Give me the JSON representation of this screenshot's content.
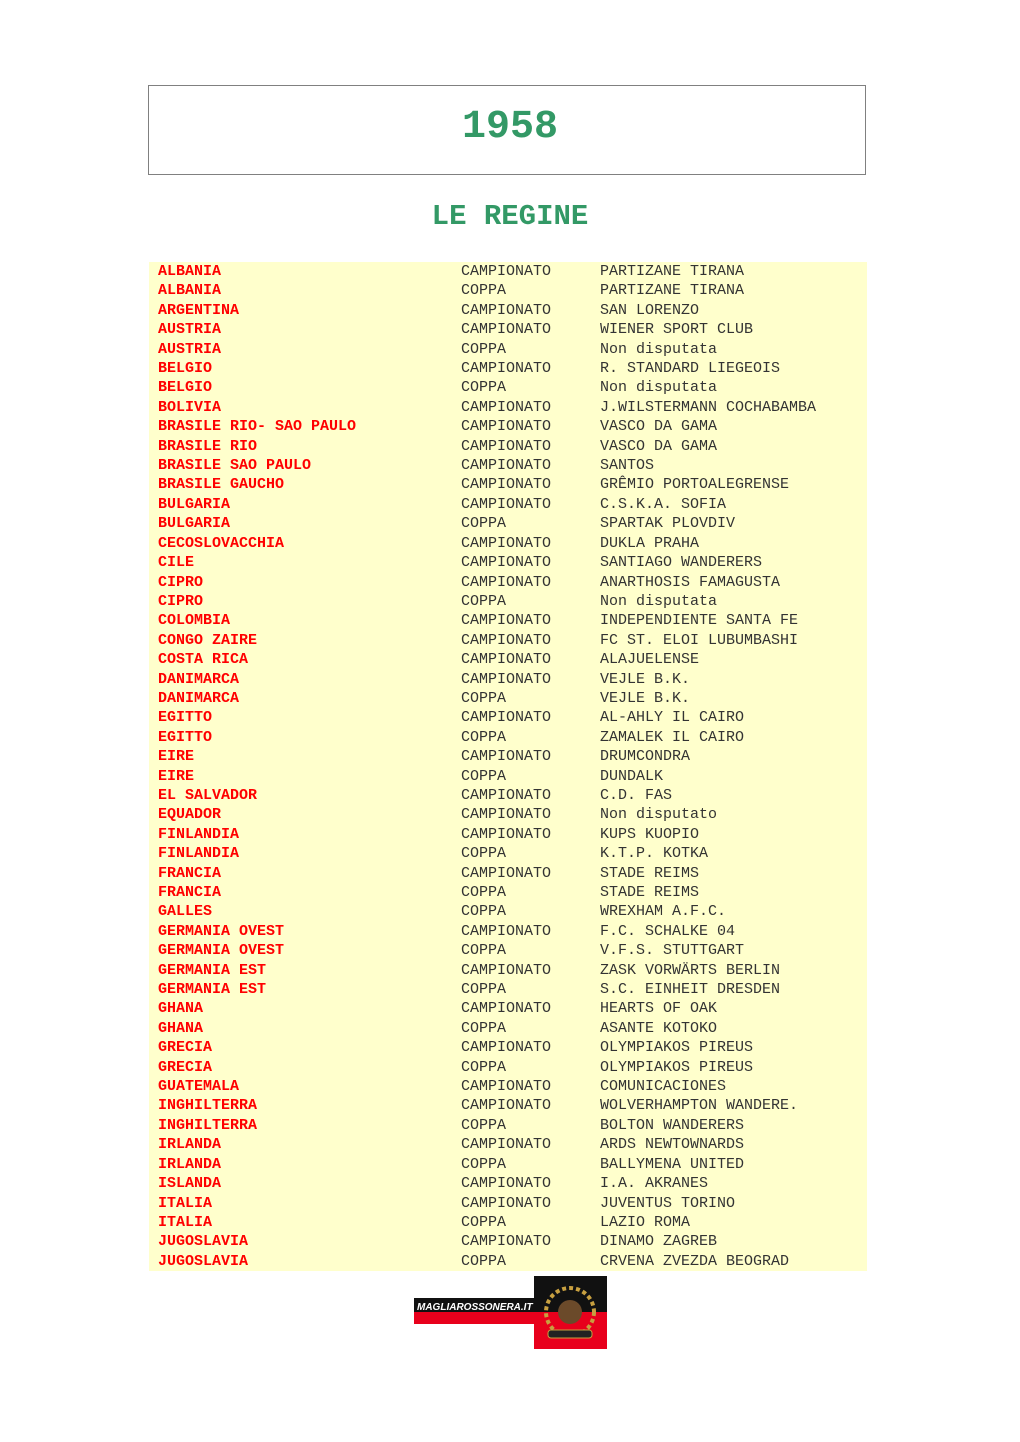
{
  "header": {
    "year": "1958",
    "subtitle": "LE REGINE"
  },
  "rows": [
    [
      "ALBANIA",
      "CAMPIONATO",
      "PARTIZANE TIRANA"
    ],
    [
      "ALBANIA",
      "COPPA",
      "PARTIZANE TIRANA"
    ],
    [
      "ARGENTINA",
      "CAMPIONATO",
      "SAN LORENZO"
    ],
    [
      "AUSTRIA",
      "CAMPIONATO",
      "WIENER SPORT CLUB"
    ],
    [
      "AUSTRIA",
      "COPPA",
      "Non disputata"
    ],
    [
      "BELGIO",
      "CAMPIONATO",
      "R. STANDARD LIEGEOIS"
    ],
    [
      "BELGIO",
      "COPPA",
      "Non disputata"
    ],
    [
      "BOLIVIA",
      "CAMPIONATO",
      "J.WILSTERMANN COCHABAMBA"
    ],
    [
      "BRASILE RIO- SAO PAULO",
      "CAMPIONATO",
      "VASCO DA GAMA"
    ],
    [
      "BRASILE RIO",
      "CAMPIONATO",
      "VASCO DA GAMA"
    ],
    [
      "BRASILE SAO PAULO",
      "CAMPIONATO",
      "SANTOS"
    ],
    [
      "BRASILE GAUCHO",
      "CAMPIONATO",
      "GRÊMIO PORTOALEGRENSE"
    ],
    [
      "BULGARIA",
      "CAMPIONATO",
      "C.S.K.A. SOFIA"
    ],
    [
      "BULGARIA",
      "COPPA",
      "SPARTAK PLOVDIV"
    ],
    [
      "CECOSLOVACCHIA",
      "CAMPIONATO",
      "DUKLA PRAHA"
    ],
    [
      "CILE",
      "CAMPIONATO",
      "SANTIAGO WANDERERS"
    ],
    [
      "CIPRO",
      "CAMPIONATO",
      "ANARTHOSIS FAMAGUSTA"
    ],
    [
      "CIPRO",
      "COPPA",
      "Non disputata"
    ],
    [
      "COLOMBIA",
      "CAMPIONATO",
      "INDEPENDIENTE SANTA FE"
    ],
    [
      "CONGO ZAIRE",
      "CAMPIONATO",
      "FC ST. ELOI LUBUMBASHI"
    ],
    [
      "COSTA RICA",
      "CAMPIONATO",
      "ALAJUELENSE"
    ],
    [
      "DANIMARCA",
      "CAMPIONATO",
      "VEJLE B.K."
    ],
    [
      "DANIMARCA",
      "COPPA",
      "VEJLE B.K."
    ],
    [
      "EGITTO",
      "CAMPIONATO",
      "AL-AHLY IL CAIRO"
    ],
    [
      "EGITTO",
      "COPPA",
      "ZAMALEK IL CAIRO"
    ],
    [
      "EIRE",
      "CAMPIONATO",
      "DRUMCONDRA"
    ],
    [
      "EIRE",
      "COPPA",
      "DUNDALK"
    ],
    [
      "EL SALVADOR",
      "CAMPIONATO",
      "C.D. FAS"
    ],
    [
      "EQUADOR",
      "CAMPIONATO",
      "Non disputato"
    ],
    [
      "FINLANDIA",
      "CAMPIONATO",
      "KUPS KUOPIO"
    ],
    [
      "FINLANDIA",
      "COPPA",
      "K.T.P. KOTKA"
    ],
    [
      "FRANCIA",
      "CAMPIONATO",
      "STADE REIMS"
    ],
    [
      "FRANCIA",
      "COPPA",
      "STADE REIMS"
    ],
    [
      "GALLES",
      "COPPA",
      "WREXHAM A.F.C."
    ],
    [
      "GERMANIA OVEST",
      "CAMPIONATO",
      "F.C. SCHALKE 04"
    ],
    [
      "GERMANIA OVEST",
      "COPPA",
      "V.F.S. STUTTGART"
    ],
    [
      "GERMANIA EST",
      "CAMPIONATO",
      "ZASK VORWÄRTS BERLIN"
    ],
    [
      "GERMANIA EST",
      "COPPA",
      "S.C. EINHEIT DRESDEN"
    ],
    [
      "GHANA",
      "CAMPIONATO",
      "HEARTS OF OAK"
    ],
    [
      "GHANA",
      "COPPA",
      "ASANTE KOTOKO"
    ],
    [
      "GRECIA",
      "CAMPIONATO",
      "OLYMPIAKOS PIREUS"
    ],
    [
      "GRECIA",
      "COPPA",
      "OLYMPIAKOS PIREUS"
    ],
    [
      "GUATEMALA",
      "CAMPIONATO",
      "COMUNICACIONES"
    ],
    [
      "INGHILTERRA",
      "CAMPIONATO",
      "WOLVERHAMPTON WANDERE."
    ],
    [
      "INGHILTERRA",
      "COPPA",
      "BOLTON WANDERERS"
    ],
    [
      "IRLANDA",
      "CAMPIONATO",
      "ARDS NEWTOWNARDS"
    ],
    [
      "IRLANDA",
      "COPPA",
      "BALLYMENA UNITED"
    ],
    [
      "ISLANDA",
      "CAMPIONATO",
      "I.A. AKRANES"
    ],
    [
      "ITALIA",
      "CAMPIONATO",
      "JUVENTUS TORINO"
    ],
    [
      "ITALIA",
      "COPPA",
      "LAZIO ROMA"
    ],
    [
      "JUGOSLAVIA",
      "CAMPIONATO",
      "DINAMO ZAGREB"
    ],
    [
      "JUGOSLAVIA",
      "COPPA",
      "CRVENA ZVEZDA BEOGRAD"
    ]
  ],
  "logo": {
    "text": "MAGLIAROSSONERA.IT",
    "badge": "MAGLIA ROSSONERA"
  },
  "colors": {
    "heading": "#339966",
    "country": "#ff0000",
    "table_bg": "#ffffcc"
  }
}
